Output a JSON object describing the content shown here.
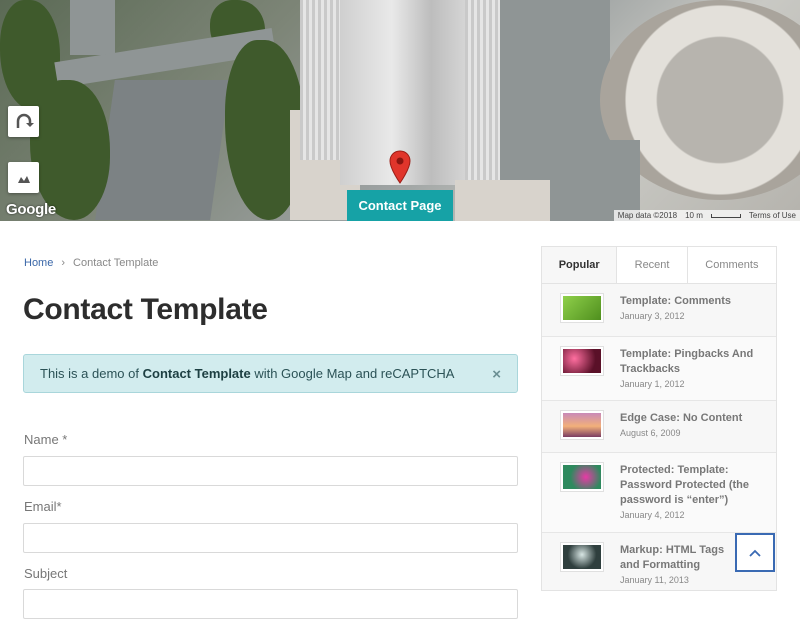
{
  "map": {
    "logo": "Google",
    "attribution": "Map data ©2018",
    "scale": "10 m",
    "terms": "Terms of Use",
    "tab_label": "Contact Page"
  },
  "breadcrumb": {
    "home": "Home",
    "separator": "›",
    "current": "Contact Template"
  },
  "page_title": "Contact Template",
  "alert": {
    "prefix": "This is a demo of ",
    "bold": "Contact Template",
    "suffix": " with Google Map and reCAPTCHA",
    "close": "×"
  },
  "form": {
    "name_label": "Name *",
    "email_label": "Email*",
    "subject_label": "Subject",
    "name_value": "",
    "email_value": "",
    "subject_value": ""
  },
  "sidebar": {
    "tabs": [
      "Popular",
      "Recent",
      "Comments"
    ],
    "active_tab": "Popular",
    "posts": [
      {
        "title": "Template: Comments",
        "date": "January 3, 2012",
        "thumb_color": "#6fae2b"
      },
      {
        "title": "Template: Pingbacks And Trackbacks",
        "date": "January 1, 2012",
        "thumb_color": "#8a1f3d"
      },
      {
        "title": "Edge Case: No Content",
        "date": "August 6, 2009",
        "thumb_color": "#9b6a8c"
      },
      {
        "title": "Protected: Template: Password Protected (the password is “enter”)",
        "date": "January 4, 2012",
        "thumb_color": "#2e8a5e"
      },
      {
        "title": "Markup: HTML Tags and Formatting",
        "date": "January 11, 2013",
        "thumb_color": "#2f3f3e"
      }
    ]
  },
  "colors": {
    "accent": "#16a2a6",
    "link": "#3a67a8",
    "back_to_top": "#3a6ab3"
  },
  "icons": [
    "rotate-icon",
    "satellite-icon",
    "map-pin-icon",
    "chevron-up-icon"
  ]
}
